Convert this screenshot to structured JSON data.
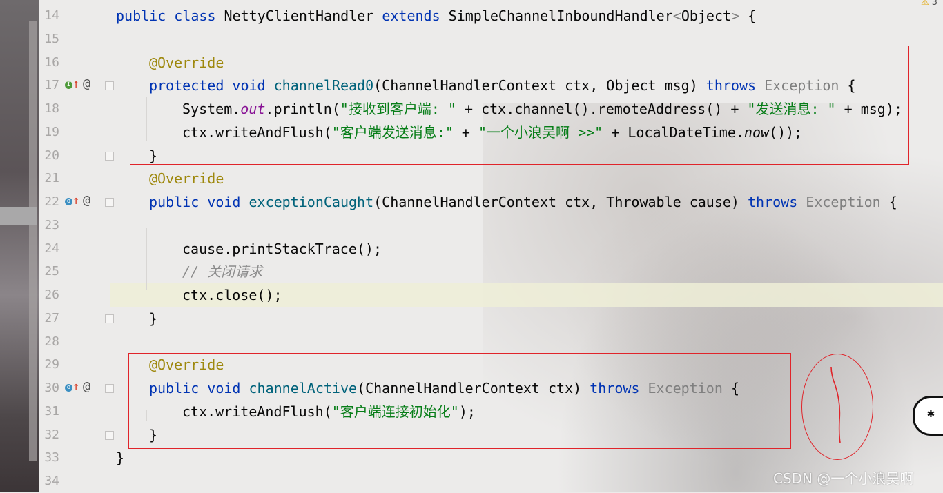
{
  "editor": {
    "warning_count": "3",
    "watermark": "CSDN @一个小浪吴啊",
    "lines": [
      {
        "number": "14",
        "tokens": [
          [
            "kw",
            "public "
          ],
          [
            "kw",
            "class "
          ],
          [
            "",
            "NettyClientHandler "
          ],
          [
            "kw",
            "extends "
          ],
          [
            "",
            "SimpleChannelInboundHandler"
          ],
          [
            "exc",
            "<"
          ],
          [
            "",
            "Object"
          ],
          [
            "exc",
            "> "
          ],
          [
            "",
            "{"
          ]
        ]
      },
      {
        "number": "15",
        "tokens": []
      },
      {
        "number": "16",
        "tokens": [
          [
            "ann",
            "@Override"
          ]
        ]
      },
      {
        "number": "17",
        "tokens": [
          [
            "kw",
            "protected "
          ],
          [
            "kw",
            "void "
          ],
          [
            "fn",
            "channelRead0"
          ],
          [
            "",
            "(ChannelHandlerContext ctx, Object msg) "
          ],
          [
            "kw",
            "throws "
          ],
          [
            "exc",
            "Exception "
          ],
          [
            "",
            "{"
          ]
        ]
      },
      {
        "number": "18",
        "tokens": [
          [
            "",
            "System."
          ],
          [
            "stat",
            "out"
          ],
          [
            "",
            ".println("
          ],
          [
            "str",
            "\"接收到客户端: \""
          ],
          [
            "",
            " + ctx.channel().remoteAddress() + "
          ],
          [
            "str",
            "\"发送消息: \""
          ],
          [
            "",
            " + msg);"
          ]
        ]
      },
      {
        "number": "19",
        "tokens": [
          [
            "",
            "ctx.writeAndFlush("
          ],
          [
            "str",
            "\"客户端发送消息:\""
          ],
          [
            "",
            " + "
          ],
          [
            "str",
            "\"一个小浪吴啊 >>\""
          ],
          [
            "",
            " + LocalDateTime."
          ],
          [
            "ital",
            "now"
          ],
          [
            "",
            "());"
          ]
        ]
      },
      {
        "number": "20",
        "tokens": [
          [
            "",
            "}"
          ]
        ]
      },
      {
        "number": "21",
        "tokens": [
          [
            "ann",
            "@Override"
          ]
        ]
      },
      {
        "number": "22",
        "tokens": [
          [
            "kw",
            "public "
          ],
          [
            "kw",
            "void "
          ],
          [
            "fn",
            "exceptionCaught"
          ],
          [
            "",
            "(ChannelHandlerContext ctx, Throwable cause) "
          ],
          [
            "kw",
            "throws "
          ],
          [
            "exc",
            "Exception "
          ],
          [
            "",
            "{"
          ]
        ]
      },
      {
        "number": "23",
        "tokens": []
      },
      {
        "number": "24",
        "tokens": [
          [
            "",
            "cause.printStackTrace();"
          ]
        ]
      },
      {
        "number": "25",
        "tokens": [
          [
            "cmt",
            "// 关闭请求"
          ]
        ]
      },
      {
        "number": "26",
        "tokens": [
          [
            "",
            "ctx.close();"
          ]
        ]
      },
      {
        "number": "27",
        "tokens": [
          [
            "",
            "}"
          ]
        ]
      },
      {
        "number": "28",
        "tokens": []
      },
      {
        "number": "29",
        "tokens": [
          [
            "ann",
            "@Override"
          ]
        ]
      },
      {
        "number": "30",
        "tokens": [
          [
            "kw",
            "public "
          ],
          [
            "kw",
            "void "
          ],
          [
            "fn",
            "channelActive"
          ],
          [
            "",
            "(ChannelHandlerContext ctx) "
          ],
          [
            "kw",
            "throws "
          ],
          [
            "exc",
            "Exception "
          ],
          [
            "",
            "{"
          ]
        ]
      },
      {
        "number": "31",
        "tokens": [
          [
            "",
            "ctx.writeAndFlush("
          ],
          [
            "str",
            "\"客户端连接初始化\""
          ],
          [
            "",
            ");"
          ]
        ]
      },
      {
        "number": "32",
        "tokens": [
          [
            "",
            "}"
          ]
        ]
      },
      {
        "number": "33",
        "tokens": [
          [
            "",
            "}"
          ]
        ]
      },
      {
        "number": "34",
        "tokens": []
      }
    ],
    "gutter_icons": [
      {
        "line": "17",
        "icons": [
          "implements-icon",
          "override-up-icon",
          "annotation-at-icon"
        ],
        "symbols": [
          "I",
          "↑",
          "@"
        ]
      },
      {
        "line": "22",
        "icons": [
          "overrides-icon",
          "override-up-icon",
          "annotation-at-icon"
        ],
        "symbols": [
          "o",
          "↑",
          "@"
        ]
      },
      {
        "line": "30",
        "icons": [
          "overrides-icon",
          "override-up-icon",
          "annotation-at-icon"
        ],
        "symbols": [
          "o",
          "↑",
          "@"
        ]
      }
    ],
    "float_button_icon": "bug-icon",
    "float_button_symbol": "✱"
  }
}
